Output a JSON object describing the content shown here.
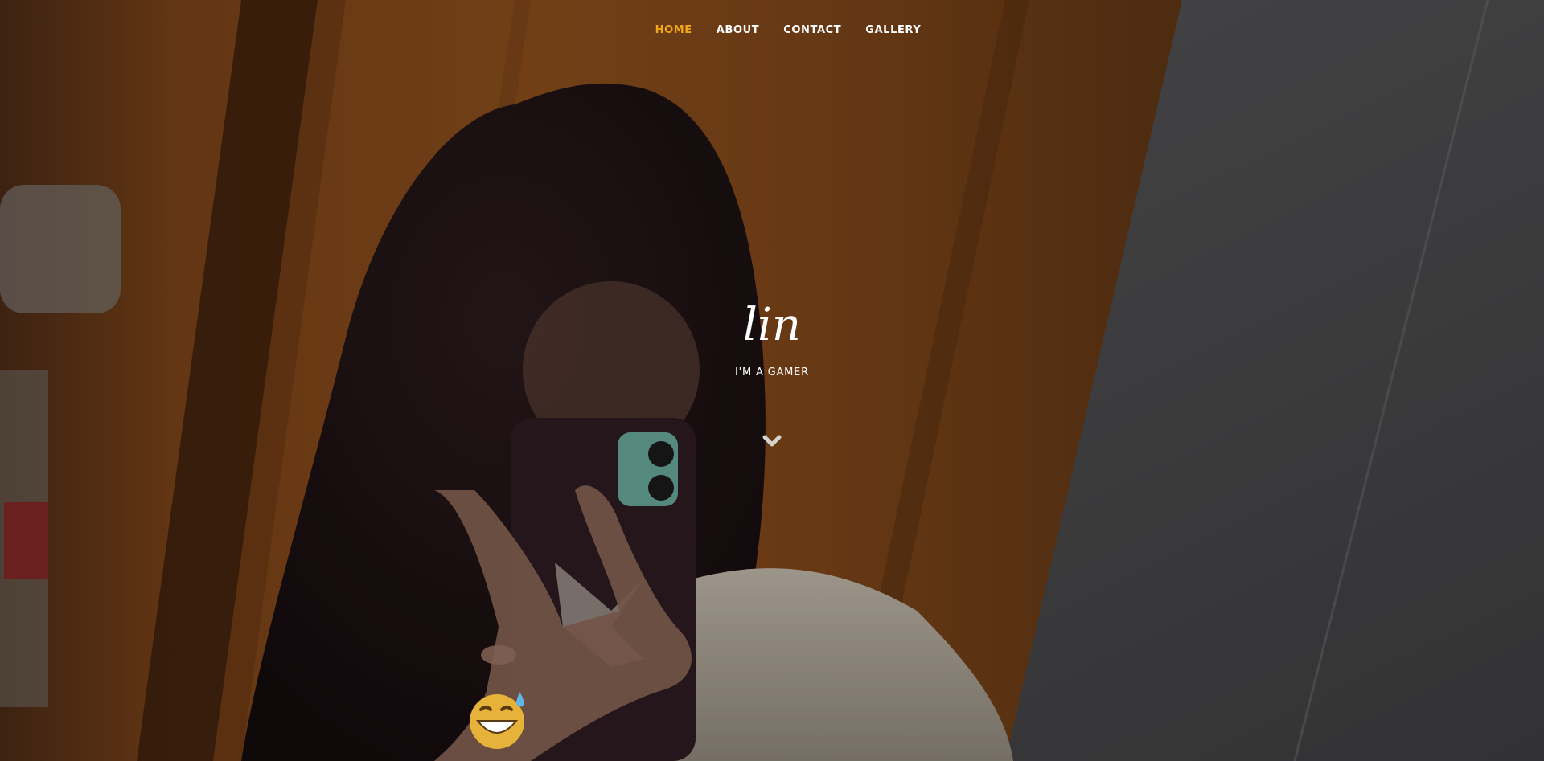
{
  "nav": {
    "items": [
      {
        "label": "HOME",
        "active": true
      },
      {
        "label": "ABOUT",
        "active": false
      },
      {
        "label": "CONTACT",
        "active": false
      },
      {
        "label": "GALLERY",
        "active": false
      }
    ],
    "active_color": "#f0a71c"
  },
  "hero": {
    "title": "lin",
    "subtitle": "I'M A GAMER",
    "scroll_icon": "chevron-down-icon",
    "emoji_icon": "grinning-sweat-emoji"
  }
}
